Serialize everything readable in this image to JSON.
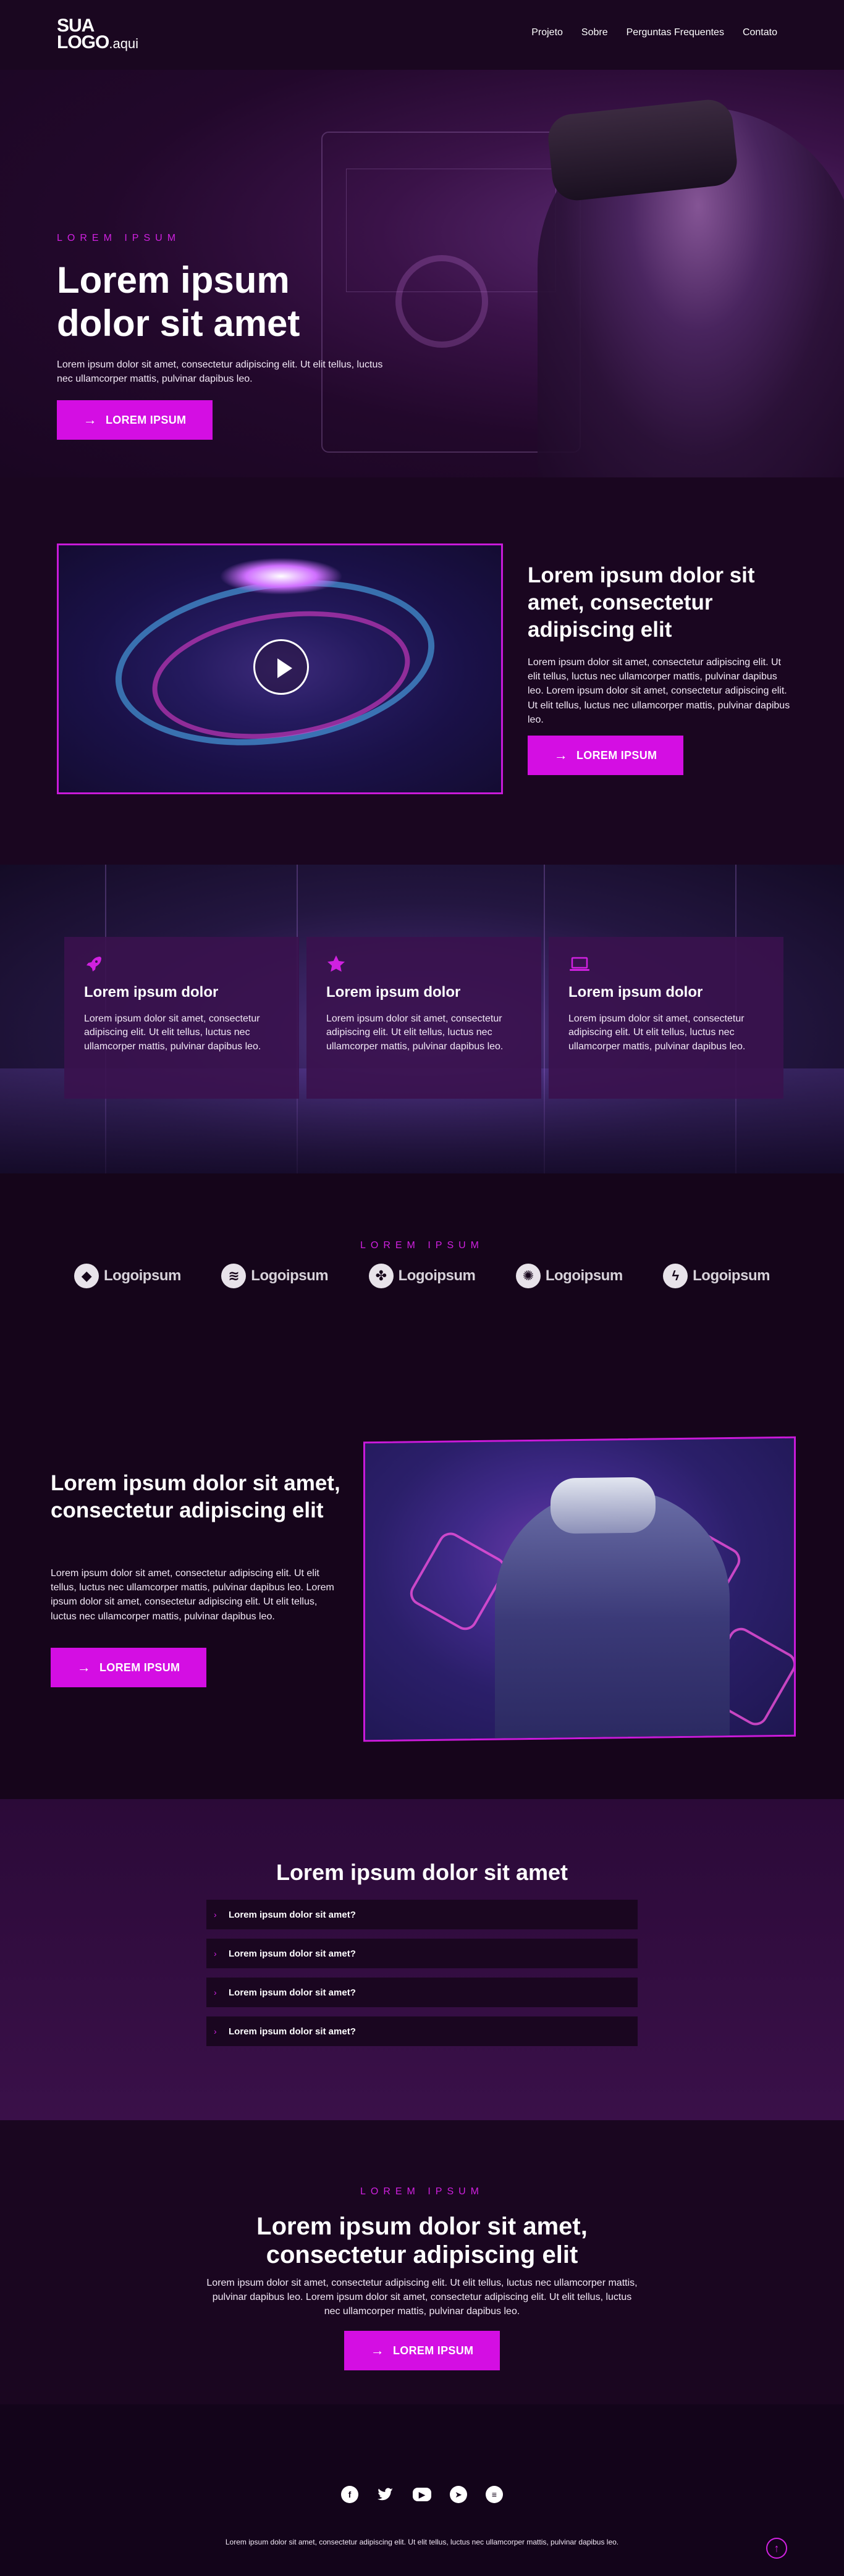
{
  "header": {
    "logo_line1": "SUA",
    "logo_line2": "LOGO",
    "logo_domain": ".aqui",
    "nav": [
      "Projeto",
      "Sobre",
      "Perguntas Frequentes",
      "Contato"
    ]
  },
  "hero": {
    "eyebrow": "LOREM IPSUM",
    "title": "Lorem ipsum dolor sit amet",
    "text": "Lorem ipsum dolor sit amet, consectetur adipiscing elit. Ut elit tellus, luctus nec ullamcorper mattis, pulvinar dapibus leo.",
    "button": "LOREM IPSUM"
  },
  "video": {
    "title": "Lorem ipsum dolor sit amet, consectetur adipiscing elit",
    "text": "Lorem ipsum dolor sit amet, consectetur adipiscing elit. Ut elit tellus, luctus nec ullamcorper mattis, pulvinar dapibus leo. Lorem ipsum dolor sit amet, consectetur adipiscing elit. Ut elit tellus, luctus nec ullamcorper mattis, pulvinar dapibus leo.",
    "button": "LOREM IPSUM"
  },
  "features": [
    {
      "icon": "rocket-icon",
      "title": "Lorem ipsum dolor",
      "text": "Lorem ipsum dolor sit amet, consectetur adipiscing elit. Ut elit tellus, luctus nec ullamcorper mattis, pulvinar dapibus leo."
    },
    {
      "icon": "star-icon",
      "title": "Lorem ipsum dolor",
      "text": "Lorem ipsum dolor sit amet, consectetur adipiscing elit. Ut elit tellus, luctus nec ullamcorper mattis, pulvinar dapibus leo."
    },
    {
      "icon": "laptop-icon",
      "title": "Lorem ipsum dolor",
      "text": "Lorem ipsum dolor sit amet, consectetur adipiscing elit. Ut elit tellus, luctus nec ullamcorper mattis, pulvinar dapibus leo."
    }
  ],
  "logos": {
    "eyebrow": "LOREM IPSUM",
    "items": [
      "Logoipsum",
      "Logoipsum",
      "Logoipsum",
      "Logoipsum",
      "Logoipsum"
    ]
  },
  "vr": {
    "title": "Lorem ipsum dolor sit amet, consectetur adipiscing elit",
    "text": "Lorem ipsum dolor sit amet, consectetur adipiscing elit. Ut elit tellus, luctus nec ullamcorper mattis, pulvinar dapibus leo. Lorem ipsum dolor sit amet, consectetur adipiscing elit. Ut elit tellus, luctus nec ullamcorper mattis, pulvinar dapibus leo.",
    "button": "LOREM IPSUM"
  },
  "faq": {
    "title": "Lorem ipsum dolor sit amet",
    "items": [
      "Lorem ipsum dolor sit amet?",
      "Lorem ipsum dolor sit amet?",
      "Lorem ipsum dolor sit amet?",
      "Lorem ipsum dolor sit amet?"
    ]
  },
  "cta": {
    "eyebrow": "LOREM IPSUM",
    "title": "Lorem ipsum dolor sit amet, consectetur adipiscing elit",
    "text": "Lorem ipsum dolor sit amet, consectetur adipiscing elit. Ut elit tellus, luctus nec ullamcorper mattis, pulvinar dapibus leo. Lorem ipsum dolor sit amet, consectetur adipiscing elit. Ut elit tellus, luctus nec ullamcorper mattis, pulvinar dapibus leo.",
    "button": "LOREM IPSUM"
  },
  "footer": {
    "socials": [
      "facebook-icon",
      "twitter-icon",
      "youtube-icon",
      "telegram-icon",
      "spotify-icon"
    ],
    "text": "Lorem ipsum dolor sit amet, consectetur adipiscing elit. Ut elit tellus, luctus nec ullamcorper mattis, pulvinar dapibus leo."
  },
  "colors": {
    "accent": "#d40ee3",
    "background": "#15051a",
    "card": "#3a124e"
  }
}
